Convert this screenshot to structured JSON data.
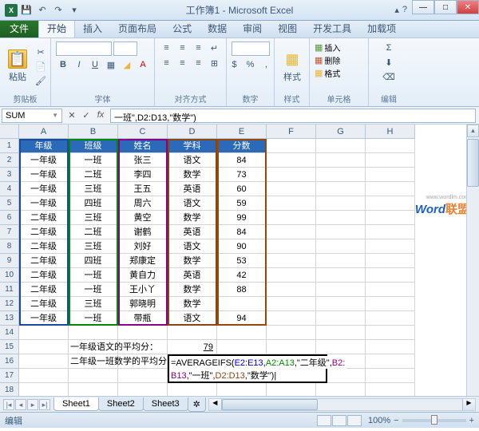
{
  "title": "工作簿1 - Microsoft Excel",
  "qat": {
    "save": "💾",
    "undo": "↶",
    "redo": "↷"
  },
  "tabs": {
    "file": "文件",
    "items": [
      "开始",
      "插入",
      "页面布局",
      "公式",
      "数据",
      "审阅",
      "视图",
      "开发工具",
      "加载项"
    ],
    "activeIndex": 0
  },
  "ribbon": {
    "clipboard": {
      "paste": "粘贴",
      "label": "剪贴板"
    },
    "font": {
      "label": "字体",
      "bold": "B",
      "italic": "I",
      "underline": "U"
    },
    "align": {
      "label": "对齐方式"
    },
    "number": {
      "label": "数字"
    },
    "styles": {
      "label": "样式",
      "btn": "样式"
    },
    "cells": {
      "label": "单元格",
      "insert": "插入",
      "delete": "删除",
      "format": "格式"
    },
    "editing": {
      "label": "编辑"
    }
  },
  "nameBox": "SUM",
  "formulaBar": "一班\",D2:D13,\"数学\")",
  "columns": [
    "A",
    "B",
    "C",
    "D",
    "E",
    "F",
    "G",
    "H"
  ],
  "headers": [
    "年级",
    "班级",
    "姓名",
    "学科",
    "分数"
  ],
  "rows": [
    [
      "一年级",
      "一班",
      "张三",
      "语文",
      "84"
    ],
    [
      "一年级",
      "二班",
      "李四",
      "数学",
      "73"
    ],
    [
      "一年级",
      "三班",
      "王五",
      "英语",
      "60"
    ],
    [
      "一年级",
      "四班",
      "周六",
      "语文",
      "59"
    ],
    [
      "二年级",
      "三班",
      "黄空",
      "数学",
      "99"
    ],
    [
      "二年级",
      "二班",
      "谢鹤",
      "英语",
      "84"
    ],
    [
      "二年级",
      "三班",
      "刘好",
      "语文",
      "90"
    ],
    [
      "二年级",
      "四班",
      "郑康定",
      "数学",
      "53"
    ],
    [
      "二年级",
      "一班",
      "黄自力",
      "英语",
      "42"
    ],
    [
      "二年级",
      "一班",
      "王小丫",
      "数学",
      "88"
    ],
    [
      "二年级",
      "三班",
      "郭晓明",
      "数学",
      ""
    ],
    [
      "一年级",
      "一班",
      "带瓶",
      "语文",
      "94"
    ]
  ],
  "labels": {
    "r15": "一年级语文的平均分：",
    "r16": "二年级一班数学的平均分：",
    "r15val": "79"
  },
  "formulaCell": {
    "line1": {
      "pre": "=AVERAGEIFS(",
      "a": "E2:E13",
      "c1": ",",
      "b": "A2:A13",
      "c2": ",\"二年级\",",
      "c": "B2:"
    },
    "line2": {
      "a": "B13",
      "c1": ",\"一班\",",
      "b": "D2:D13",
      "c2": ",\"数学\")",
      "cursor": "|"
    }
  },
  "sheets": [
    "Sheet1",
    "Sheet2",
    "Sheet3"
  ],
  "status": {
    "mode": "编辑",
    "zoom": "100%"
  },
  "watermark": {
    "w": "W",
    "ord": "ord",
    "cn": "联盟",
    "url": "www.wordlm.com"
  }
}
